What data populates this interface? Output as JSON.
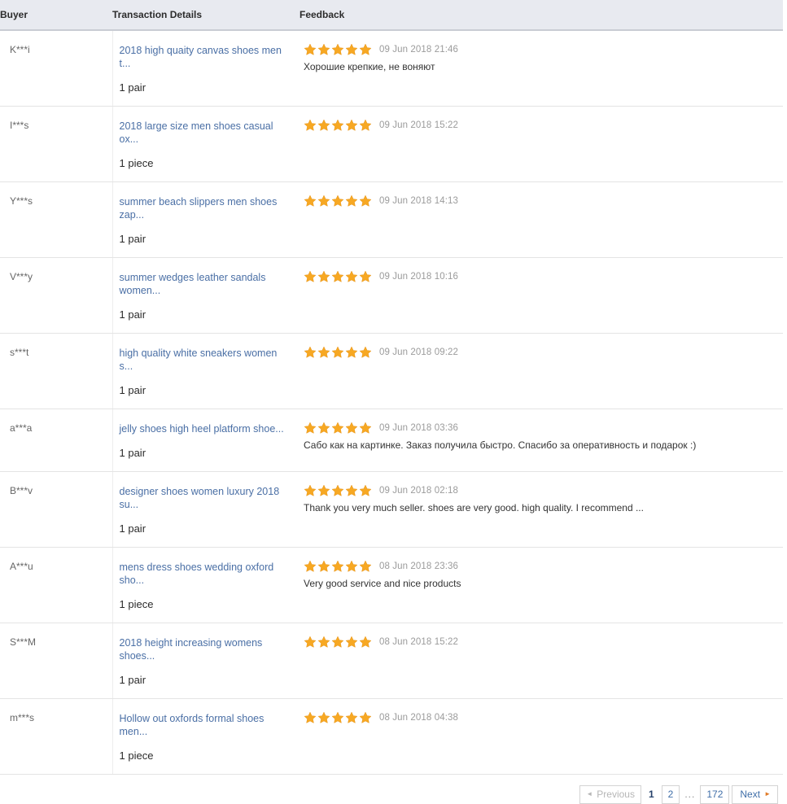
{
  "table": {
    "columns": [
      "Buyer",
      "Transaction Details",
      "Feedback"
    ],
    "rows": [
      {
        "buyer": "K***i",
        "product": "2018 high quaity canvas shoes men t...",
        "quantity": "1 pair",
        "stars": 5,
        "date": "09 Jun 2018 21:46",
        "comment": "Хорошие крепкие, не воняют"
      },
      {
        "buyer": "I***s",
        "product": "2018 large size men shoes casual ox...",
        "quantity": "1 piece",
        "stars": 5,
        "date": "09 Jun 2018 15:22",
        "comment": ""
      },
      {
        "buyer": "Y***s",
        "product": "summer beach slippers men shoes zap...",
        "quantity": "1 pair",
        "stars": 5,
        "date": "09 Jun 2018 14:13",
        "comment": ""
      },
      {
        "buyer": "V***y",
        "product": "summer wedges leather sandals women...",
        "quantity": "1 pair",
        "stars": 5,
        "date": "09 Jun 2018 10:16",
        "comment": ""
      },
      {
        "buyer": "s***t",
        "product": "high quality white sneakers women s...",
        "quantity": "1 pair",
        "stars": 5,
        "date": "09 Jun 2018 09:22",
        "comment": ""
      },
      {
        "buyer": "a***a",
        "product": "jelly shoes high heel platform shoe...",
        "quantity": "1 pair",
        "stars": 5,
        "date": "09 Jun 2018 03:36",
        "comment": "Сабо как на картинке. Заказ получила быстро. Спасибо за оперативность и подарок :)"
      },
      {
        "buyer": "B***v",
        "product": "designer shoes women luxury 2018 su...",
        "quantity": "1 pair",
        "stars": 5,
        "date": "09 Jun 2018 02:18",
        "comment": "Thank you very much seller. shoes are very good. high quality. I recommend ..."
      },
      {
        "buyer": "A***u",
        "product": "mens dress shoes wedding oxford sho...",
        "quantity": "1 piece",
        "stars": 5,
        "date": "08 Jun 2018 23:36",
        "comment": "Very good service and nice products"
      },
      {
        "buyer": "S***M",
        "product": "2018 height increasing womens shoes...",
        "quantity": "1 pair",
        "stars": 5,
        "date": "08 Jun 2018 15:22",
        "comment": ""
      },
      {
        "buyer": "m***s",
        "product": "Hollow out oxfords formal shoes men...",
        "quantity": "1 piece",
        "stars": 5,
        "date": "08 Jun 2018 04:38",
        "comment": ""
      }
    ]
  },
  "pagination": {
    "previous_label": "Previous",
    "next_label": "Next",
    "pages": [
      "1",
      "2"
    ],
    "ellipsis": "...",
    "last_page": "172",
    "current_page": "1",
    "prev_arrow": "◄",
    "next_arrow": "►"
  },
  "colors": {
    "star": "#f7a823",
    "link": "#4a6fa5",
    "header_bg": "#e8eaf0",
    "date": "#9b9b9b"
  }
}
